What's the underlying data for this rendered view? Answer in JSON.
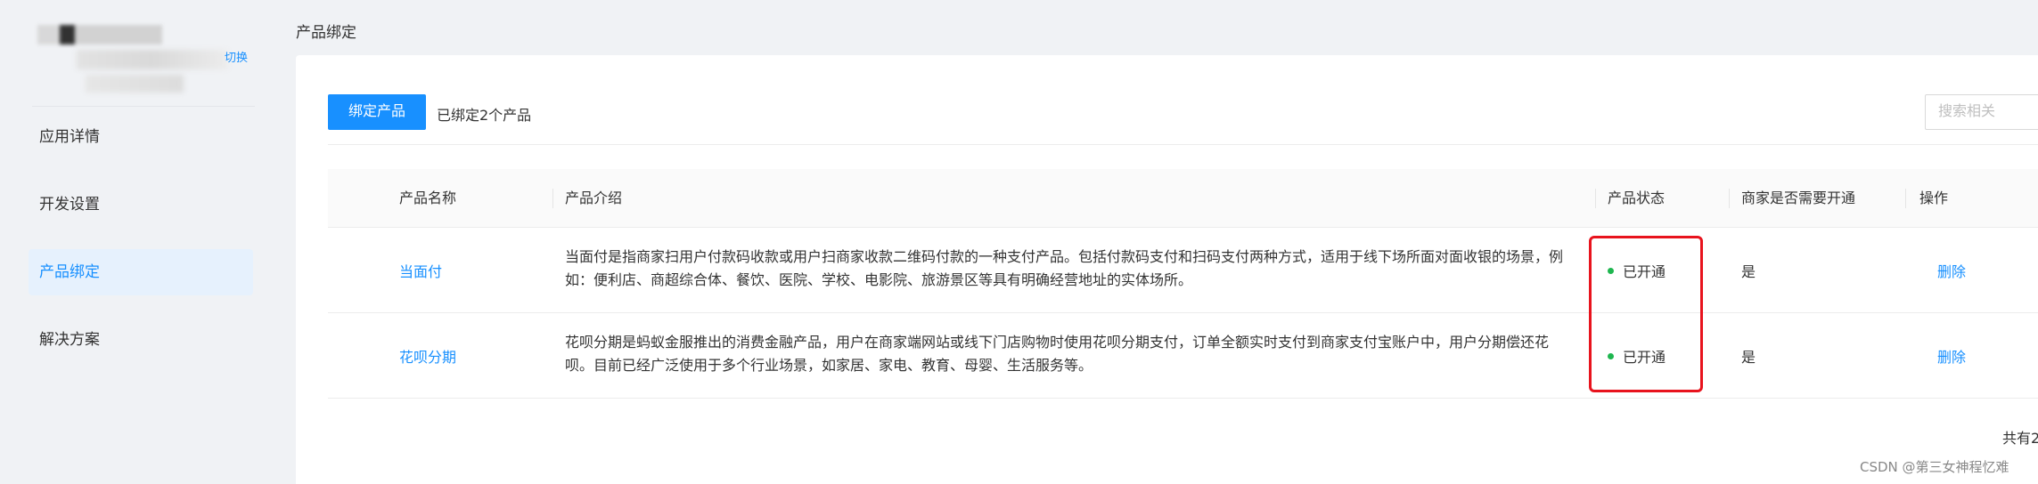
{
  "sidebar": {
    "switch_label": "切换",
    "items": [
      {
        "label": "应用详情",
        "active": false
      },
      {
        "label": "开发设置",
        "active": false
      },
      {
        "label": "产品绑定",
        "active": true
      },
      {
        "label": "解决方案",
        "active": false
      }
    ]
  },
  "page": {
    "title": "产品绑定"
  },
  "toolbar": {
    "bind_button": "绑定产品",
    "bound_count": "已绑定2个产品",
    "search_placeholder": "搜索相关"
  },
  "table": {
    "columns": [
      "产品名称",
      "产品介绍",
      "产品状态",
      "商家是否需要开通",
      "操作"
    ],
    "rows": [
      {
        "name": "当面付",
        "desc": "当面付是指商家扫用户付款码收款或用户扫商家收款二维码付款的一种支付产品。包括付款码支付和扫码支付两种方式，适用于线下场所面对面收银的场景，例如：便利店、商超综合体、餐饮、医院、学校、电影院、旅游景区等具有明确经营地址的实体场所。",
        "status": "已开通",
        "need_open": "是",
        "op": "删除"
      },
      {
        "name": "花呗分期",
        "desc": "花呗分期是蚂蚁金服推出的消费金融产品，用户在商家端网站或线下门店购物时使用花呗分期支付，订单全额实时支付到商家支付宝账户中，用户分期偿还花呗。目前已经广泛使用于多个行业场景，如家居、家电、教育、母婴、生活服务等。",
        "status": "已开通",
        "need_open": "是",
        "op": "删除"
      }
    ]
  },
  "footer": {
    "total": "共有2"
  },
  "watermark": "CSDN @第三女神程忆难",
  "colors": {
    "accent": "#1890ff",
    "status_ok": "#1eb64f",
    "highlight": "#e8131d"
  }
}
